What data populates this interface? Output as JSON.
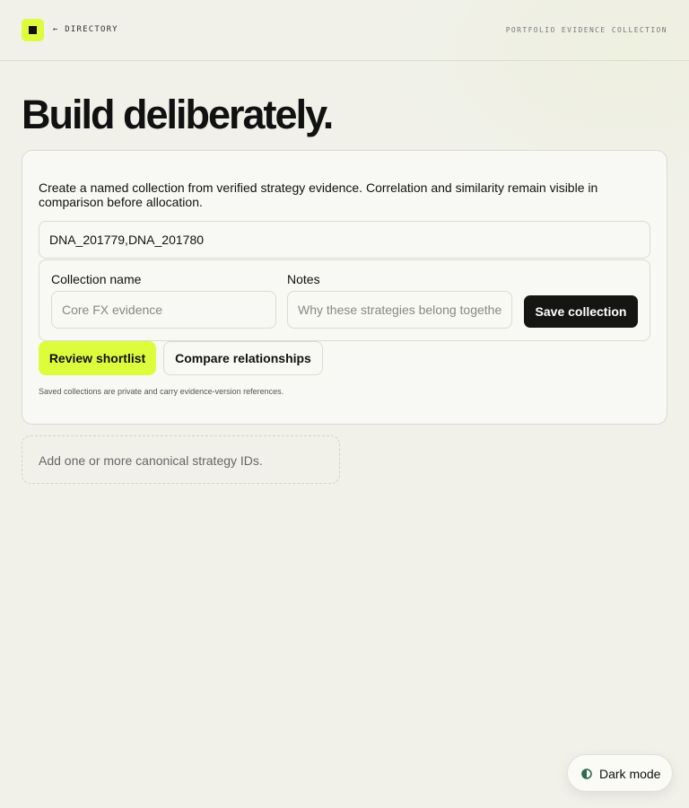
{
  "header": {
    "back_link": "← DIRECTORY",
    "section": "PORTFOLIO EVIDENCE COLLECTION"
  },
  "page": {
    "title": "Build deliberately."
  },
  "card": {
    "description": "Create a named collection from verified strategy evidence. Correlation and similarity remain visible in comparison before allocation.",
    "strategy_ids_value": "DNA_201779,DNA_201780",
    "collection_name_label": "Collection name",
    "collection_name_placeholder": "Core FX evidence",
    "notes_label": "Notes",
    "notes_placeholder": "Why these strategies belong together",
    "save_label": "Save collection",
    "review_label": "Review shortlist",
    "compare_label": "Compare relationships",
    "footnote": "Saved collections are private and carry evidence-version references."
  },
  "empty_state": {
    "message": "Add one or more canonical strategy IDs."
  },
  "theme_toggle": {
    "label": "Dark mode",
    "icon": "half-circle-icon"
  },
  "colors": {
    "accent": "#dcfc3c",
    "primary_button": "#151514",
    "background": "#f1f1ea",
    "toggle_icon": "#2f6b4f"
  }
}
